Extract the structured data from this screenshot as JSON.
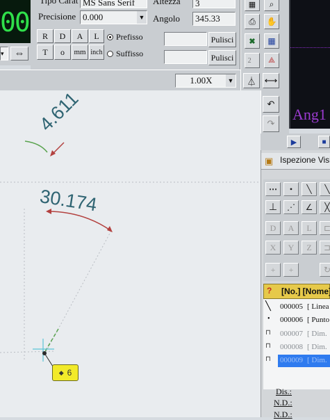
{
  "toolbar": {
    "font_label": "Tipo Carat",
    "font_value": "MS Sans Serif",
    "precision_label": "Precisione",
    "precision_value": "0.000",
    "height_label": "Altezza",
    "height_value": "3",
    "angle_label": "Angolo",
    "angle_value": "345.33",
    "style_buttons": [
      "R",
      "D",
      "A",
      "L",
      "T",
      "o",
      "mm",
      "inch"
    ],
    "prefix_label": "Prefisso",
    "suffix_label": "Suffisso",
    "clear_label": "Pulisci",
    "zoom_value": "1.00X",
    "arrow_icon": "double-arrow-icon"
  },
  "status_display": {
    "digits": "00",
    "ang_text": "Ang1"
  },
  "canvas": {
    "dim_small": "4.611",
    "dim_large": "30.174",
    "point_tag": "6",
    "colors": {
      "dimension_text": "#2f6472",
      "arc": "#b3413f",
      "green_line": "#59a34e",
      "tag_bg": "#f2ea2a"
    }
  },
  "inspection_panel": {
    "title": "Ispezione Visiva",
    "columns": [
      "?",
      "[No.] [Nome]"
    ],
    "rows": [
      {
        "num": "000005",
        "name": "[ Linea",
        "selected": false,
        "greyed": false,
        "icon": "line-icon"
      },
      {
        "num": "000006",
        "name": "[ Punto",
        "selected": false,
        "greyed": false,
        "icon": "point-icon"
      },
      {
        "num": "000007",
        "name": "[ Dim.",
        "selected": false,
        "greyed": true,
        "icon": "dimension-icon"
      },
      {
        "num": "000008",
        "name": "[ Dim.",
        "selected": false,
        "greyed": true,
        "icon": "dimension-icon"
      },
      {
        "num": "000009",
        "name": "[ Dim.",
        "selected": true,
        "greyed": false,
        "icon": "dimension-icon"
      }
    ],
    "footer": [
      "Dis.:",
      "N.D.:",
      "N.D.:"
    ]
  }
}
